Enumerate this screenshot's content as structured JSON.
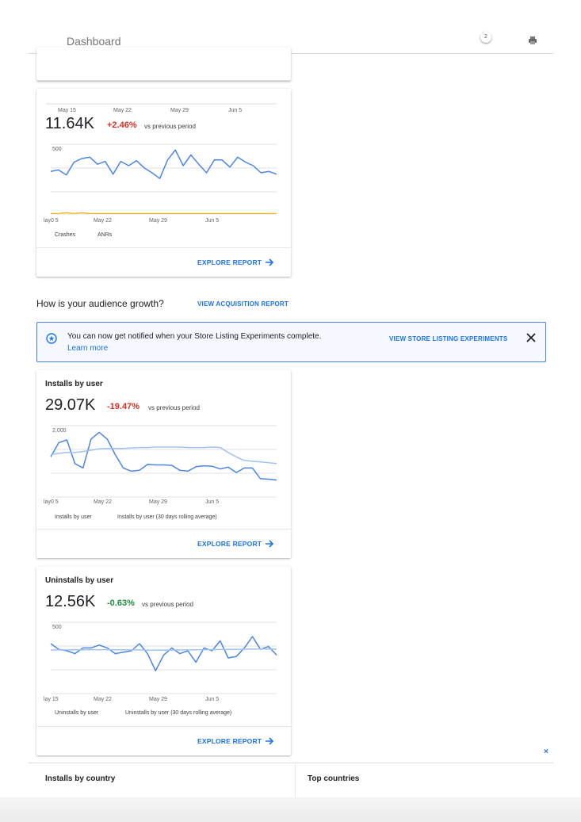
{
  "header": {
    "title": "Dashboard",
    "notification_count": "2",
    "print_icon": "printer-icon"
  },
  "crashes_card": {
    "top_ticks": [
      "May 15",
      "May 22",
      "May 29",
      "Jun 5"
    ],
    "big": "11.64K",
    "delta": "+2.46%",
    "vs": "vs previous period",
    "y_tick": "500",
    "bottom_ticks": [
      "lay0 5",
      "May 22",
      "May 29",
      "Jun 5"
    ],
    "legend": [
      "Crashes",
      "ANRs"
    ],
    "explore": "EXPLORE REPORT",
    "colors": {
      "crashes": "#4a86e8",
      "anrs": "#f4b400"
    }
  },
  "audience": {
    "title": "How is your audience growth?",
    "link": "VIEW ACQUISITION REPORT"
  },
  "notice": {
    "message": "You can now get notified when your Store Listing Experiments complete.",
    "learn_more": "Learn more",
    "action": "VIEW STORE LISTING EXPERIMENTS"
  },
  "installs_card": {
    "title": "Installs by user",
    "big": "29.07K",
    "delta": "-19.47%",
    "vs": "vs previous period",
    "y_tick": "2,000",
    "ticks": [
      "lay0 5",
      "May 22",
      "May 29",
      "Jun 5"
    ],
    "legend": [
      "Installs by user",
      "Installs by user (30 days rolling average)"
    ],
    "explore": "EXPLORE REPORT"
  },
  "uninstalls_card": {
    "title": "Uninstalls by user",
    "big": "12.56K",
    "delta": "-0.63%",
    "vs": "vs previous period",
    "y_tick": "500",
    "ticks": [
      "lay 15",
      "May 22",
      "May 29",
      "Jun 5"
    ],
    "legend": [
      "Uninstalls by user",
      "Uninstalls by user (30 days rolling average)"
    ],
    "explore": "EXPLORE REPORT"
  },
  "bottom": {
    "installs_by_country": "Installs by country",
    "top_countries": "Top countries"
  },
  "chart_data": [
    {
      "type": "line",
      "series": [
        {
          "values": [
            62,
            64,
            57,
            75,
            80,
            82,
            72,
            76,
            58,
            76,
            70,
            77,
            67,
            60,
            52,
            78,
            92,
            70,
            85,
            72,
            60,
            78,
            78,
            68,
            82,
            75,
            70,
            60,
            62,
            58
          ]
        },
        {
          "values": [
            3,
            3,
            4,
            3,
            4,
            3,
            3,
            3,
            3,
            3,
            3,
            3,
            3,
            3,
            3,
            3,
            3,
            3,
            3,
            3,
            3,
            3,
            3,
            3,
            3,
            3,
            3,
            3,
            3,
            3
          ]
        }
      ]
    },
    {
      "type": "line",
      "series": [
        {
          "values": [
            1500,
            1820,
            1880,
            1350,
            1250,
            1900,
            2050,
            1900,
            1550,
            1250,
            1180,
            1200,
            1330,
            1320,
            1320,
            1310,
            1200,
            1180,
            1280,
            1300,
            1290,
            1230,
            1270,
            1150,
            1250,
            1250,
            1010,
            1000,
            980
          ]
        },
        {
          "values": [
            1550,
            1580,
            1600,
            1600,
            1620,
            1650,
            1680,
            1690,
            1690,
            1690,
            1700,
            1710,
            1710,
            1720,
            1720,
            1720,
            1720,
            1710,
            1710,
            1710,
            1720,
            1710,
            1600,
            1500,
            1420,
            1400,
            1390,
            1370,
            1350
          ]
        }
      ]
    },
    {
      "type": "line",
      "series": [
        {
          "values": [
            450,
            410,
            400,
            380,
            420,
            420,
            440,
            420,
            380,
            390,
            400,
            450,
            380,
            260,
            370,
            420,
            380,
            400,
            320,
            420,
            400,
            470,
            350,
            360,
            420,
            500,
            410,
            430,
            370
          ]
        },
        {
          "values": [
            405,
            406,
            406,
            407,
            407,
            408,
            408,
            408,
            407,
            407,
            406,
            406,
            405,
            404,
            404,
            405,
            406,
            406,
            407,
            408,
            408,
            409,
            410,
            410,
            411,
            412,
            412,
            413,
            413
          ]
        }
      ]
    }
  ]
}
